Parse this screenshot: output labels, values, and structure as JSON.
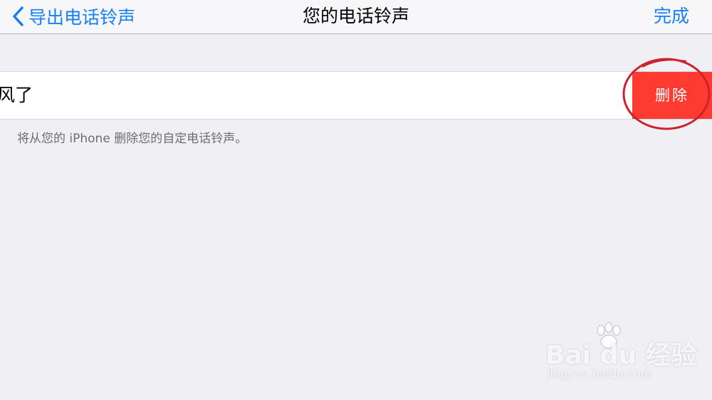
{
  "navbar": {
    "back_label": "导出电话铃声",
    "title": "您的电话铃声",
    "done_label": "完成"
  },
  "ringtone_row": {
    "label": "风了",
    "delete_label": "删除"
  },
  "footer_note": "将从您的 iPhone 删除您的自定电话铃声。",
  "watermark": {
    "brand": "Bai du 经验",
    "url": "jingyan.baidu.com"
  },
  "colors": {
    "accent": "#157efb",
    "destructive": "#fe3b30",
    "background": "#efeff4",
    "annotation": "#d0202a"
  },
  "icons": {
    "back": "chevron-left-icon"
  }
}
